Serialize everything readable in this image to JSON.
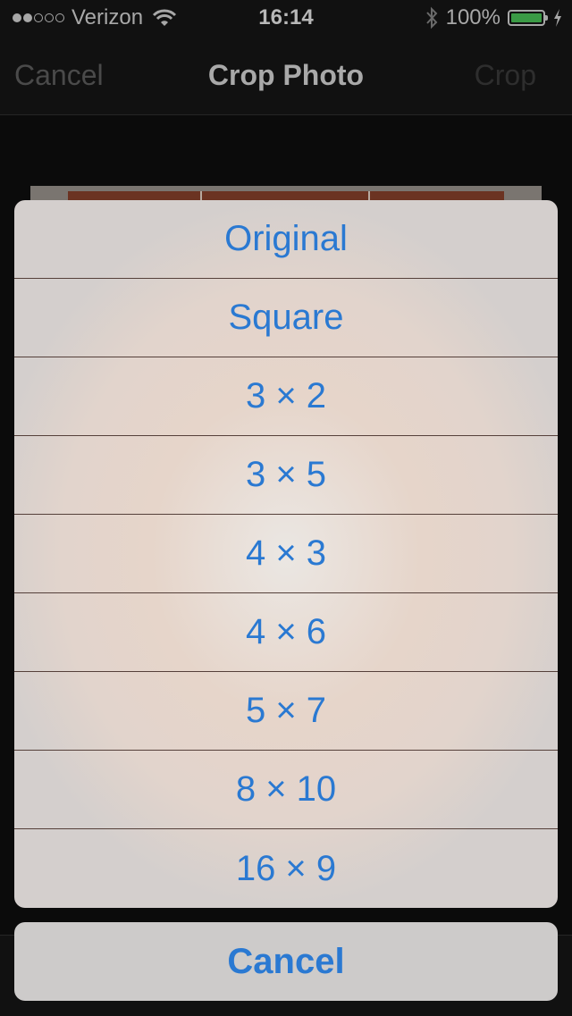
{
  "status_bar": {
    "signal_bars_filled": 2,
    "signal_bars_total": 5,
    "carrier": "Verizon",
    "wifi_icon": "wifi-icon",
    "time": "16:14",
    "bluetooth_icon": "bluetooth-icon",
    "battery_percent_label": "100%",
    "battery_level": 1.0,
    "battery_color": "#3a9a45",
    "charging_icon": "bolt-icon"
  },
  "nav_bar": {
    "cancel_label": "Cancel",
    "title": "Crop Photo",
    "crop_label": "Crop"
  },
  "action_sheet": {
    "accent_color": "#2a79d2",
    "options": [
      {
        "label": "Original"
      },
      {
        "label": "Square"
      },
      {
        "label": "3 × 2"
      },
      {
        "label": "3 × 5"
      },
      {
        "label": "4 × 3"
      },
      {
        "label": "4 × 6"
      },
      {
        "label": "5 × 7"
      },
      {
        "label": "8 × 10"
      },
      {
        "label": "16 × 9"
      }
    ],
    "cancel_label": "Cancel"
  }
}
